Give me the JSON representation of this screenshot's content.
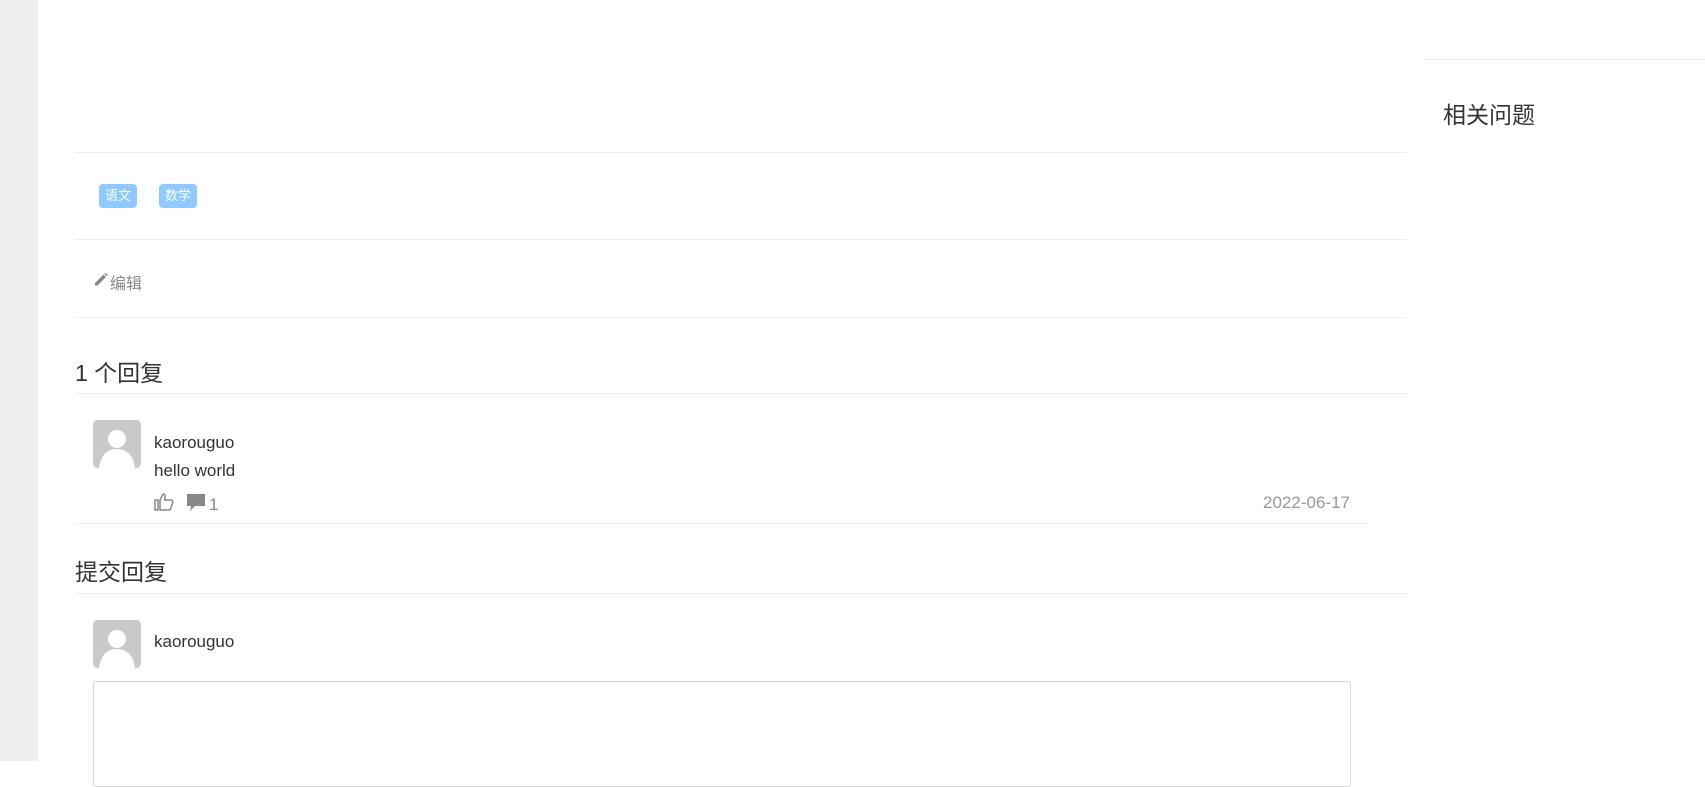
{
  "tags": [
    "语文",
    "数学"
  ],
  "edit": {
    "label": "编辑"
  },
  "replies_section": {
    "title": "1 个回复",
    "items": [
      {
        "username": "kaorouguo",
        "text": "hello world",
        "comment_count": "1",
        "date": "2022-06-17"
      }
    ]
  },
  "submit_section": {
    "title": "提交回复",
    "username": "kaorouguo",
    "textarea_value": ""
  },
  "sidebar": {
    "title": "相关问题"
  },
  "icons": {
    "edit": "pencil-icon",
    "like": "thumbs-up-icon",
    "comment": "comment-icon",
    "avatar": "default-avatar-icon"
  },
  "colors": {
    "tag_bg": "#8ec9ff",
    "divider": "#eeeeee",
    "gutter": "#eeeeee",
    "muted_text": "#888888"
  }
}
